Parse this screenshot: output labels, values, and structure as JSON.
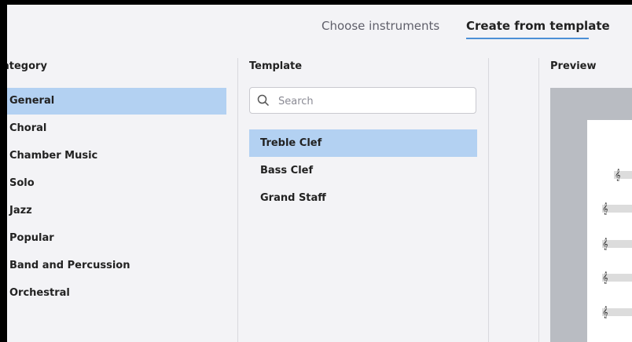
{
  "tabs": {
    "choose_instruments": "Choose instruments",
    "create_from_template": "Create from template"
  },
  "columns": {
    "category": "ategory",
    "template": "Template",
    "preview": "Preview"
  },
  "categories": [
    {
      "label": "General",
      "selected": true
    },
    {
      "label": "Choral"
    },
    {
      "label": "Chamber Music"
    },
    {
      "label": "Solo"
    },
    {
      "label": "Jazz"
    },
    {
      "label": "Popular"
    },
    {
      "label": "Band and Percussion"
    },
    {
      "label": "Orchestral"
    }
  ],
  "search": {
    "placeholder": "Search",
    "value": ""
  },
  "templates": [
    {
      "label": "Treble Clef",
      "selected": true
    },
    {
      "label": "Bass Clef"
    },
    {
      "label": "Grand Staff"
    }
  ],
  "colors": {
    "selection": "#b3d1f2",
    "tab_underline": "#4b8fd6",
    "background": "#f3f3f6",
    "preview_backdrop": "#b9bcc2"
  },
  "icons": {
    "search": "search-icon",
    "treble_clef": "treble-clef-icon"
  }
}
